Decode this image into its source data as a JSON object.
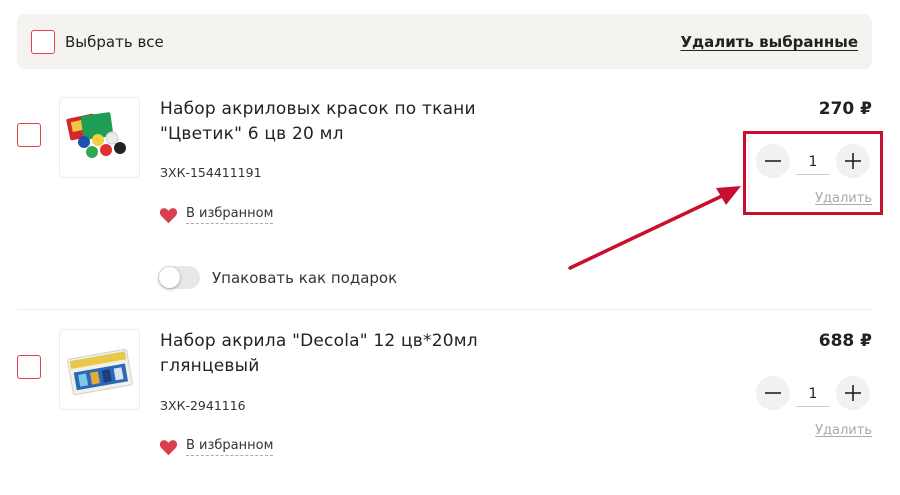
{
  "header": {
    "select_all_label": "Выбрать все",
    "delete_selected_label": "Удалить выбранные"
  },
  "items": [
    {
      "title": "Набор акриловых красок по ткани \"Цветик\" 6 цв 20 мл",
      "sku": "ЗХК-154411191",
      "favorite_label": "В избранном",
      "gift_label": "Упаковать как подарок",
      "price": "270 ₽",
      "quantity": "1",
      "remove_label": "Удалить"
    },
    {
      "title": "Набор акрила \"Decola\" 12 цв*20мл глянцевый",
      "sku": "ЗХК-2941116",
      "favorite_label": "В избранном",
      "price": "688 ₽",
      "quantity": "1",
      "remove_label": "Удалить"
    }
  ],
  "colors": {
    "accent_red": "#e0404a",
    "annotation_red": "#c8102e",
    "heart": "#d9404d",
    "select_bar_bg": "#f4f3ef"
  },
  "icons": [
    "checkbox",
    "heart-icon",
    "minus-icon",
    "plus-icon",
    "toggle-switch"
  ]
}
